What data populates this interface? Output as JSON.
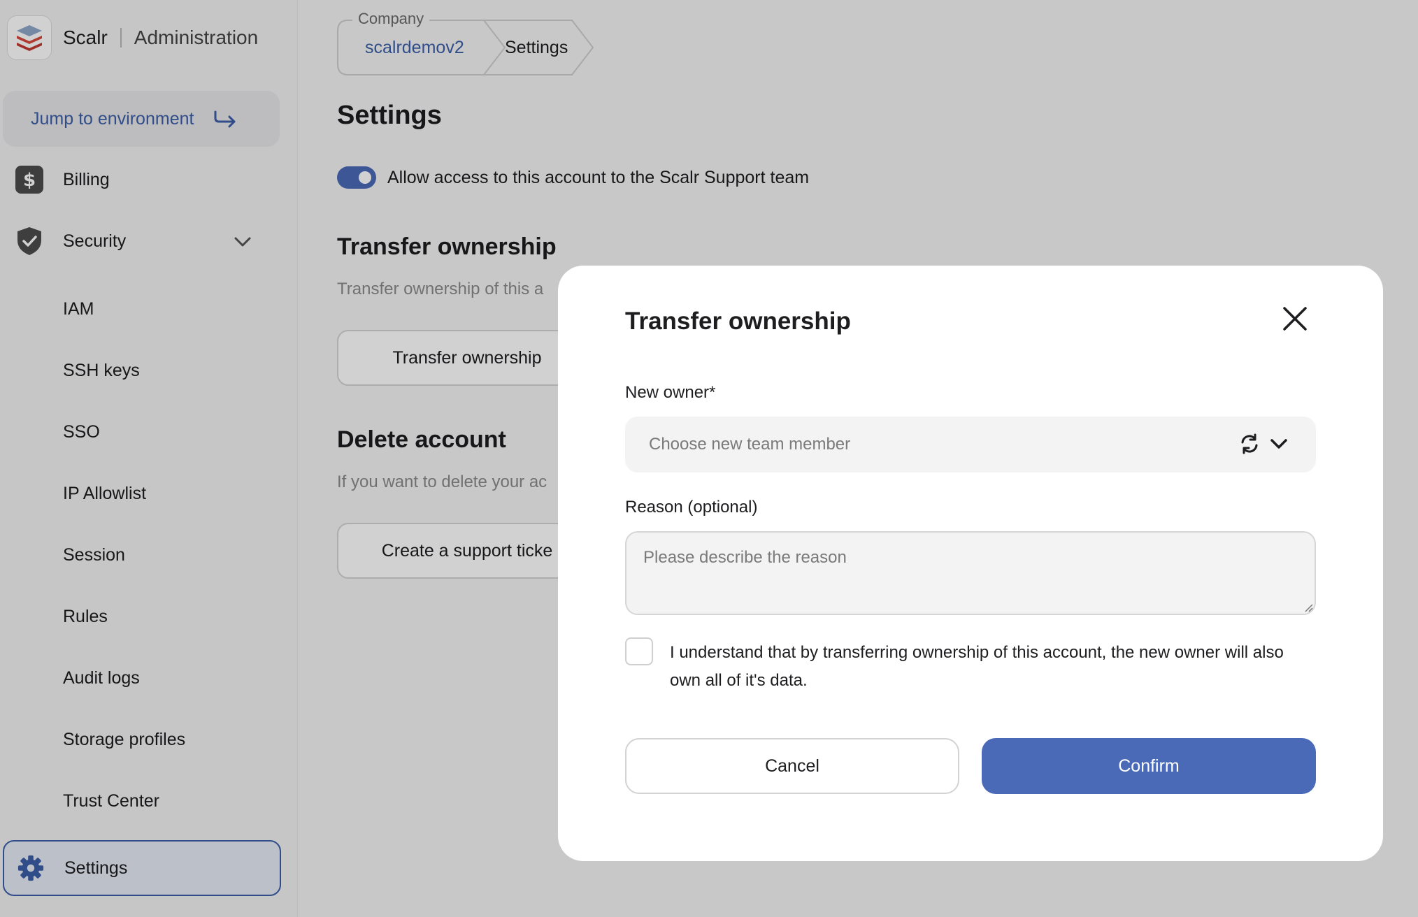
{
  "brand": {
    "name": "Scalr",
    "subtitle": "Administration"
  },
  "sidebar": {
    "jump_label": "Jump to environment",
    "items": [
      {
        "label": "Billing",
        "icon": "dollar-icon"
      },
      {
        "label": "Security",
        "icon": "shield-check-icon",
        "expanded": true
      },
      {
        "label": "Settings",
        "icon": "gear-icon",
        "active": true
      }
    ],
    "security_subitems": [
      "IAM",
      "SSH keys",
      "SSO",
      "IP Allowlist",
      "Session",
      "Rules",
      "Audit logs",
      "Storage profiles",
      "Trust Center"
    ]
  },
  "breadcrumb": {
    "legend": "Company",
    "company": "scalrdemov2",
    "current": "Settings"
  },
  "main": {
    "title": "Settings",
    "support_toggle": {
      "label": "Allow access to this account to the Scalr Support team",
      "on": true
    },
    "transfer": {
      "title": "Transfer ownership",
      "description": "Transfer ownership of this a",
      "button": "Transfer ownership"
    },
    "delete": {
      "title": "Delete account",
      "description": "If you want to delete your ac",
      "button": "Create a support ticke"
    }
  },
  "modal": {
    "title": "Transfer ownership",
    "new_owner_label": "New owner*",
    "new_owner_placeholder": "Choose new team member",
    "reason_label": "Reason (optional)",
    "reason_placeholder": "Please describe the reason",
    "ack_text": "I understand that by transferring ownership of this account, the new owner will also own all of it's data.",
    "cancel_label": "Cancel",
    "confirm_label": "Confirm"
  },
  "colors": {
    "accent": "#4a6ab8",
    "link": "#3c5fa8"
  }
}
